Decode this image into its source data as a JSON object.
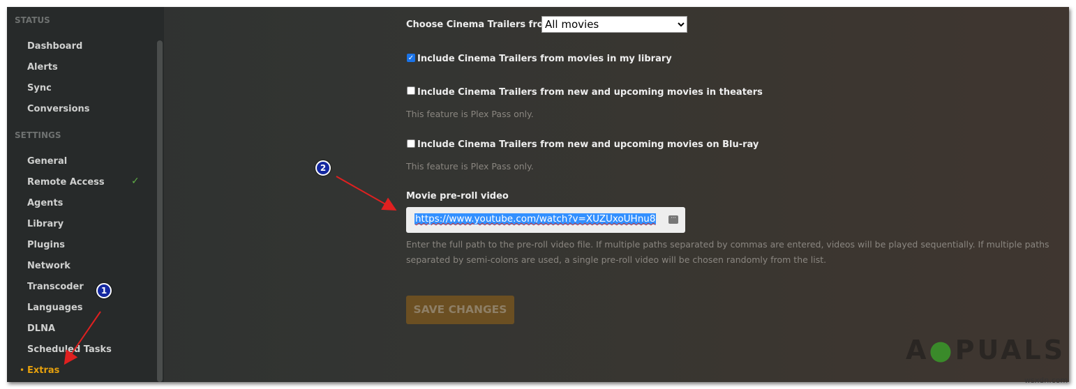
{
  "sidebar": {
    "status_heading": "STATUS",
    "status_items": [
      "Dashboard",
      "Alerts",
      "Sync",
      "Conversions"
    ],
    "settings_heading": "SETTINGS",
    "settings_items": [
      "General",
      "Remote Access",
      "Agents",
      "Library",
      "Plugins",
      "Network",
      "Transcoder",
      "Languages",
      "DLNA",
      "Scheduled Tasks",
      "Extras"
    ],
    "active_item": "Extras",
    "remote_access_status": "check-icon"
  },
  "main": {
    "trailers_label": "Choose Cinema Trailers from",
    "trailers_select": "All movies",
    "cb_library": {
      "label": "Include Cinema Trailers from movies in my library",
      "checked": true
    },
    "cb_theaters": {
      "label": "Include Cinema Trailers from new and upcoming movies in theaters",
      "checked": false,
      "note": "This feature is Plex Pass only."
    },
    "cb_bluray": {
      "label": "Include Cinema Trailers from new and upcoming movies on Blu-ray",
      "checked": false,
      "note": "This feature is Plex Pass only."
    },
    "preroll_label": "Movie pre-roll video",
    "preroll_value": "https://www.youtube.com/watch?v=XUZUxoUHnu8",
    "preroll_hint": "Enter the full path to the pre-roll video file. If multiple paths separated by commas are entered, videos will be played sequentially. If multiple paths separated by semi-colons are used, a single pre-roll video will be chosen randomly from the list.",
    "save_label": "SAVE CHANGES"
  },
  "annotations": {
    "step1": "1",
    "step2": "2",
    "arrow_color": "#e02020"
  },
  "watermark": {
    "logo": "APPUALS",
    "site": "wsxdn.com"
  },
  "colors": {
    "accent": "#e5a00d",
    "selection": "#3390ff"
  }
}
